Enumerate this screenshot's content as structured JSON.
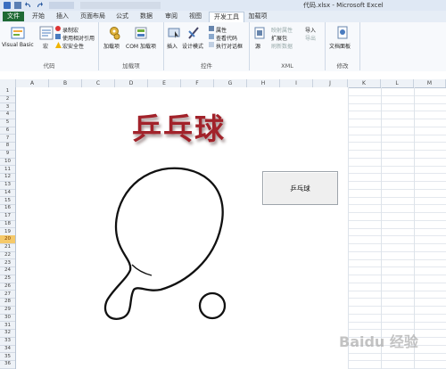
{
  "window": {
    "title": "代码.xlsx - Microsoft Excel"
  },
  "tabs": [
    "文件",
    "开始",
    "插入",
    "页面布局",
    "公式",
    "数据",
    "审阅",
    "视图",
    "开发工具",
    "加载项"
  ],
  "active_tab": "开发工具",
  "ribbon": {
    "code": {
      "name": "代码",
      "visual_basic": "Visual Basic",
      "macro": "宏",
      "record_macro": "录制宏",
      "relative_refs": "使用相对引用",
      "macro_security": "宏安全性"
    },
    "addins": {
      "name": "加载项",
      "addins": "加载项",
      "com_addins": "COM 加载项"
    },
    "controls": {
      "name": "控件",
      "insert": "插入",
      "design_mode": "设计模式",
      "properties": "属性",
      "view_code": "查看代码",
      "run_dialog": "执行对话框"
    },
    "xml": {
      "name": "XML",
      "source": "源",
      "map_properties": "映射属性",
      "expansion_packs": "扩展包",
      "refresh_data": "刷新数据",
      "import": "导入",
      "export": "导出"
    },
    "modify": {
      "name": "修改",
      "document_panel": "文档面板"
    }
  },
  "columns": [
    "A",
    "B",
    "C",
    "D",
    "E",
    "F",
    "G",
    "H",
    "I",
    "J",
    "K",
    "L",
    "M"
  ],
  "rows": [
    "1",
    "2",
    "3",
    "4",
    "5",
    "6",
    "7",
    "8",
    "9",
    "10",
    "11",
    "12",
    "13",
    "14",
    "15",
    "16",
    "17",
    "18",
    "19",
    "20",
    "21",
    "22",
    "23",
    "24",
    "25",
    "26",
    "27",
    "28",
    "29",
    "30",
    "31",
    "32",
    "33",
    "34",
    "35",
    "36"
  ],
  "selected_row": "20",
  "sheet": {
    "title_art": "乒乓球",
    "button_label": "乒乓球"
  },
  "watermark": "Baidu 经验",
  "colors": {
    "file_tab": "#1e6a35",
    "title_art": "#a2222a",
    "row_highlight": "#f5c96a"
  }
}
